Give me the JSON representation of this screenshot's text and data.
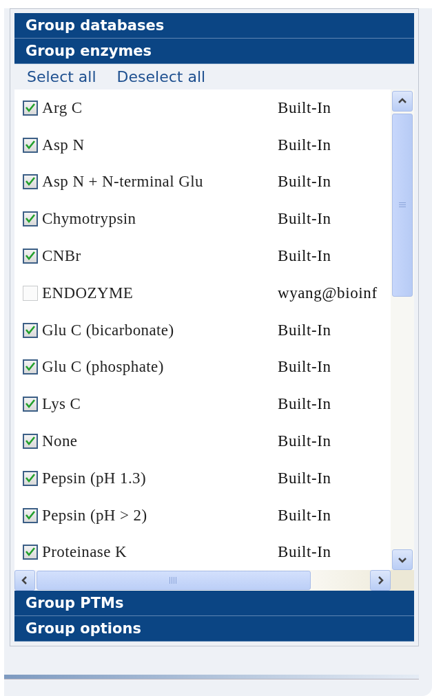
{
  "groups": [
    {
      "title": "Group databases"
    },
    {
      "title": "Group enzymes",
      "actions": [
        "Select all",
        "Deselect all"
      ],
      "enzymes": [
        {
          "name": "Arg C",
          "source": "Built-In",
          "checked": true
        },
        {
          "name": "Asp N",
          "source": "Built-In",
          "checked": true
        },
        {
          "name": "Asp N + N-terminal Glu",
          "source": "Built-In",
          "checked": true
        },
        {
          "name": "Chymotrypsin",
          "source": "Built-In",
          "checked": true
        },
        {
          "name": "CNBr",
          "source": "Built-In",
          "checked": true
        },
        {
          "name": "ENDOZYME",
          "source": "wyang@bioinf",
          "checked": false
        },
        {
          "name": "Glu C (bicarbonate)",
          "source": "Built-In",
          "checked": true
        },
        {
          "name": "Glu C (phosphate)",
          "source": "Built-In",
          "checked": true
        },
        {
          "name": "Lys C",
          "source": "Built-In",
          "checked": true
        },
        {
          "name": "None",
          "source": "Built-In",
          "checked": true
        },
        {
          "name": "Pepsin (pH 1.3)",
          "source": "Built-In",
          "checked": true
        },
        {
          "name": "Pepsin (pH > 2)",
          "source": "Built-In",
          "checked": true
        },
        {
          "name": "Proteinase K",
          "source": "Built-In",
          "checked": true
        }
      ]
    },
    {
      "title": "Group PTMs"
    },
    {
      "title": "Group options"
    }
  ]
}
